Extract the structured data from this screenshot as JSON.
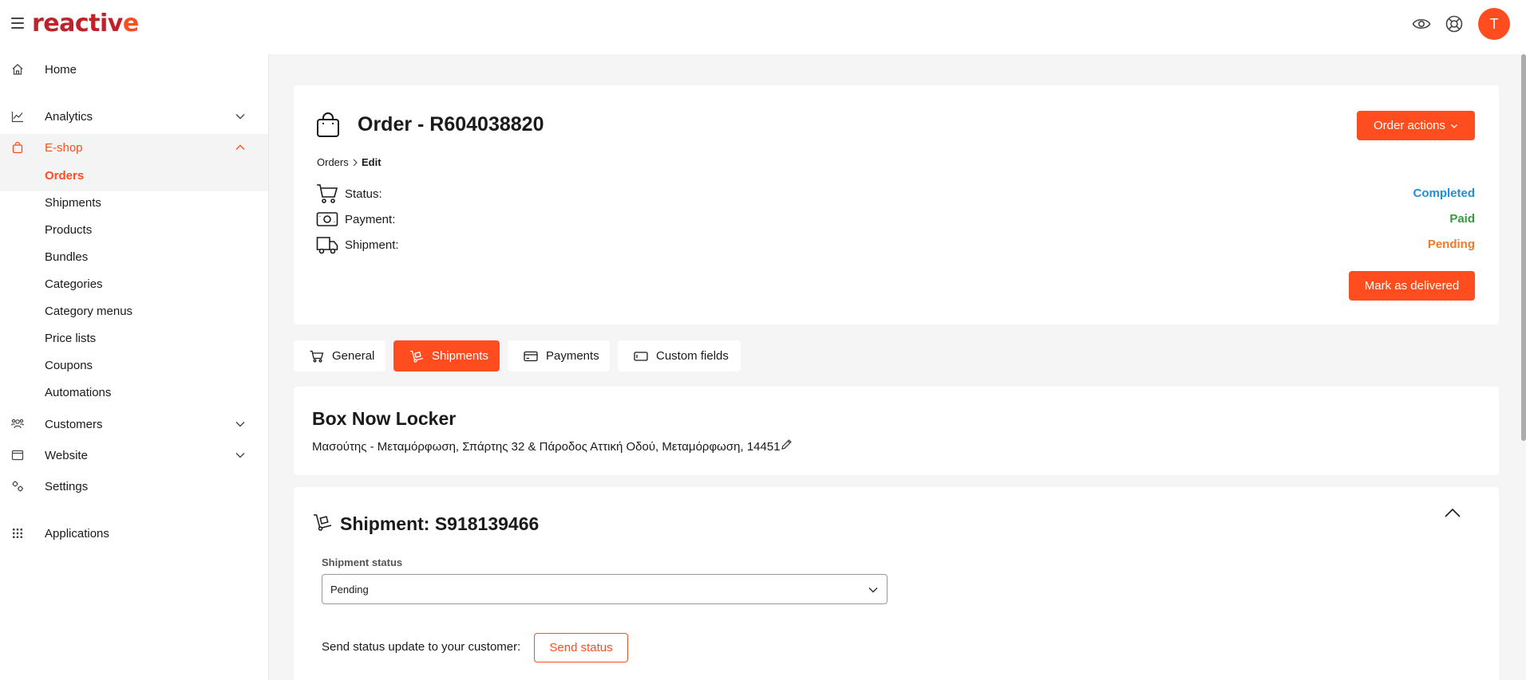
{
  "app": {
    "logo_text": "reactiv",
    "logo_last": "e",
    "avatar_initial": "T",
    "accent": "#ff4d1f"
  },
  "topbar_icons": [
    "eye-icon",
    "lifebuoy-icon"
  ],
  "sidebar": {
    "items": [
      {
        "label": "Home",
        "icon": "home-icon"
      },
      {
        "label": "Analytics",
        "icon": "chart-line-icon"
      },
      {
        "label": "E-shop",
        "icon": "shopping-bag-icon"
      },
      {
        "label": "Customers",
        "icon": "users-icon"
      },
      {
        "label": "Website",
        "icon": "browser-icon"
      },
      {
        "label": "Settings",
        "icon": "settings-icon"
      },
      {
        "label": "Applications",
        "icon": "grid-icon"
      }
    ],
    "eshop_sub": [
      "Orders",
      "Shipments",
      "Products",
      "Bundles",
      "Categories",
      "Category menus",
      "Price lists",
      "Coupons",
      "Automations"
    ]
  },
  "order": {
    "title": "Order - R604038820",
    "actions_label": "Order actions",
    "breadcrumb": [
      "Orders",
      "Edit"
    ],
    "status_label": "Status:",
    "status_value": "Completed",
    "status_color": "#1e90d8",
    "payment_label": "Payment:",
    "payment_value": "Paid",
    "payment_color": "#2e9e3a",
    "shipment_label": "Shipment:",
    "shipment_value": "Pending",
    "shipment_color": "#f07a2a",
    "mark_delivered_label": "Mark as delivered"
  },
  "tabs": [
    {
      "label": "General",
      "icon": "cart-icon"
    },
    {
      "label": "Shipments",
      "icon": "hand-truck-icon"
    },
    {
      "label": "Payments",
      "icon": "credit-card-icon"
    },
    {
      "label": "Custom fields",
      "icon": "input-field-icon"
    }
  ],
  "shipping_method": {
    "title": "Box Now Locker",
    "address": "Μασούτης - Μεταμόρφωση, Σπάρτης 32 & Πάροδος Αττική Οδού, Μεταμόρφωση, 14451"
  },
  "shipment": {
    "title": "Shipment: S918139466",
    "status_field_label": "Shipment status",
    "status_value": "Pending",
    "send_label": "Send status update to your customer:",
    "send_button": "Send status"
  }
}
